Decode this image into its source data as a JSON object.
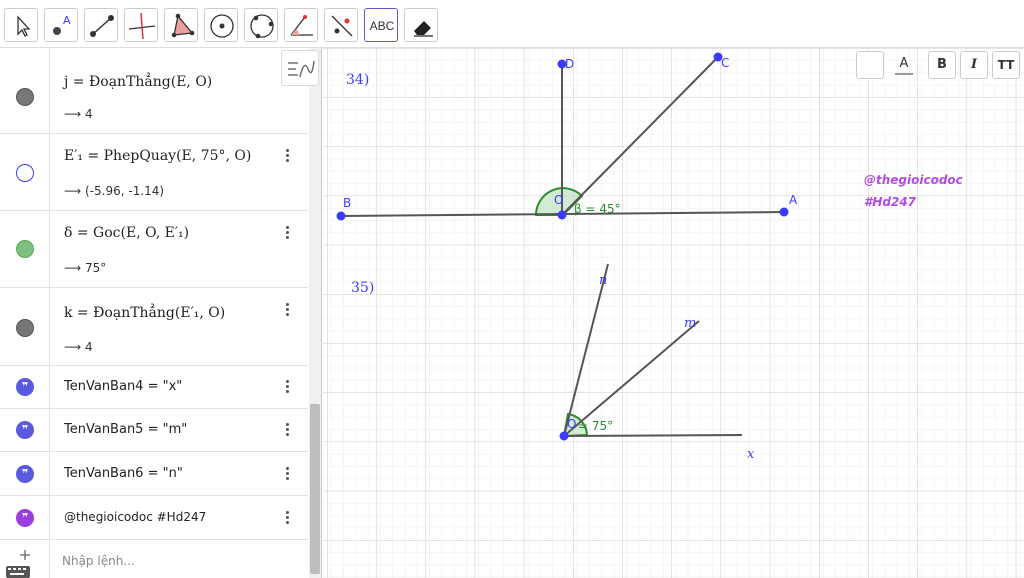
{
  "toolbar": {
    "tools": [
      {
        "name": "move-tool",
        "icon": "cursor-icon"
      },
      {
        "name": "point-tool",
        "icon": "point-icon",
        "label": "A"
      },
      {
        "name": "segment-tool",
        "icon": "segment-icon"
      },
      {
        "name": "perpendicular-tool",
        "icon": "perpendicular-icon"
      },
      {
        "name": "polygon-tool",
        "icon": "polygon-icon"
      },
      {
        "name": "circle-center-tool",
        "icon": "circle-center-icon"
      },
      {
        "name": "circle-three-points-tool",
        "icon": "circle-three-points-icon"
      },
      {
        "name": "angle-tool",
        "icon": "angle-icon"
      },
      {
        "name": "reflect-tool",
        "icon": "reflect-icon"
      },
      {
        "name": "text-tool",
        "icon": "text-icon",
        "label": "ABC"
      },
      {
        "name": "eraser-tool",
        "icon": "eraser-icon"
      }
    ]
  },
  "algebra": {
    "rows": [
      {
        "def": "j = ĐoạnThẳng(E, O)",
        "value": "⟶ 4",
        "color": "#777777",
        "filled": true
      },
      {
        "def": "E′₁ = PhepQuay(E, 75°, O)",
        "value": "⟶ (-5.96, -1.14)",
        "color": "#3b3bff",
        "filled": false
      },
      {
        "def": "δ = Goc(E, O, E′₁)",
        "value": "⟶ 75°",
        "color": "#55aa55",
        "filled": true
      },
      {
        "def": "k = ĐoạnThẳng(E′₁, O)",
        "value": "⟶ 4",
        "color": "#777777",
        "filled": true
      },
      {
        "def": "TenVanBan4 = \"x\"",
        "color": "#5a5ae0"
      },
      {
        "def": "TenVanBan5 = \"m\"",
        "color": "#5a5ae0"
      },
      {
        "def": "TenVanBan6 = \"n\"",
        "color": "#5a5ae0"
      },
      {
        "def": "@thegioicodoc #Hd247",
        "color": "#9a3ee0"
      }
    ],
    "input_placeholder": "Nhập lệnh..."
  },
  "style_bar": {
    "bold": "B",
    "italic": "I",
    "text_size": "TT",
    "text_color": "A"
  },
  "graphics": {
    "label_34": "34)",
    "label_35": "35)",
    "watermark_1": "@thegioicodoc",
    "watermark_2": "#Hd247",
    "points": {
      "A": "A",
      "B": "B",
      "C": "C",
      "D": "D",
      "O": "O",
      "O2": "O"
    },
    "angle_beta": "β = 45°",
    "angle_alpha": "= 75°",
    "ray_n": "n",
    "ray_m": "m",
    "ray_x": "x",
    "accent_color": "#3b3bff",
    "angle_color": "#2e8b2e",
    "watermark_color": "#b14ae6"
  }
}
